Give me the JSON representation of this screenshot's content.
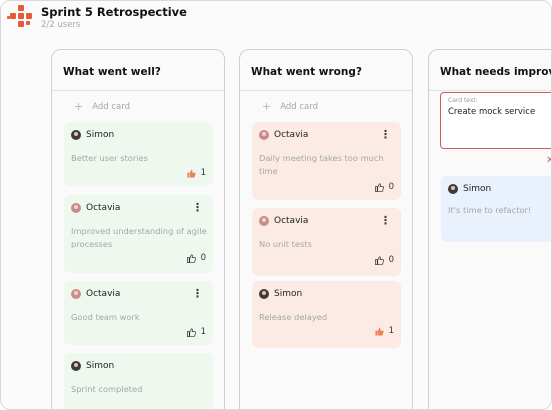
{
  "board": {
    "title": "Sprint 5 Retrospective",
    "users": "2/2 users"
  },
  "add_card_label": "Add card",
  "columns": [
    {
      "title": "What went well?",
      "cards": [
        {
          "user": "Simon",
          "text": "Better user stories",
          "likes": "1"
        },
        {
          "user": "Octavia",
          "text": "Improved understanding of agile processes",
          "likes": "0"
        },
        {
          "user": "Octavia",
          "text": "Good team work",
          "likes": "1"
        },
        {
          "user": "Simon",
          "text": "Sprint completed"
        }
      ]
    },
    {
      "title": "What went wrong?",
      "cards": [
        {
          "user": "Octavia",
          "text": "Daily meeting takes too much time",
          "likes": "0"
        },
        {
          "user": "Octavia",
          "text": "No unit tests",
          "likes": "0"
        },
        {
          "user": "Simon",
          "text": "Release delayed",
          "likes": "1"
        }
      ]
    },
    {
      "title": "What needs improvement?",
      "edit": {
        "label": "Card text:",
        "value": "Create mock service"
      },
      "cards": [
        {
          "user": "Simon",
          "text": "It's time to refactor!"
        }
      ]
    }
  ],
  "colors": {
    "brand": "#e45c38",
    "well": "#eef8ef",
    "wrong": "#fbebe4",
    "improve": "#e9f1fc",
    "liked": "#e8825a"
  },
  "icons": {
    "logo": "app-logo",
    "add": "plus-icon",
    "menu": "kebab-menu-icon",
    "like": "thumbs-up-icon",
    "close": "close-icon"
  }
}
